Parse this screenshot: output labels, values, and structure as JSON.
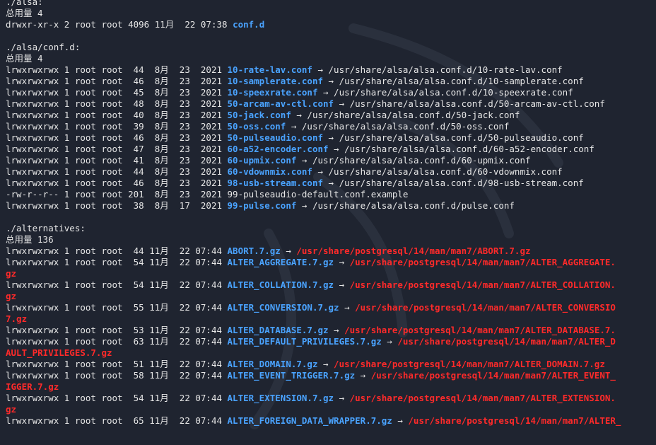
{
  "colors": {
    "background": "#1f2430",
    "text": "#e6e6e6",
    "link_name": "#4aa3ff",
    "broken_target": "#ff2a2a"
  },
  "lines": [
    {
      "text": "./alsa:"
    },
    {
      "text": "总用量 4"
    },
    {
      "prefix": "drwxr-xr-x 2 root root 4096 11月  22 07:38 ",
      "name": "conf.d",
      "name_class": "dir"
    },
    {
      "text": ""
    },
    {
      "text": "./alsa/conf.d:"
    },
    {
      "text": "总用量 4"
    },
    {
      "prefix": "lrwxrwxrwx 1 root root  44  8月  23  2021 ",
      "name": "10-rate-lav.conf",
      "name_class": "dir",
      "arrow": " → ",
      "target": "/usr/share/alsa/alsa.conf.d/10-rate-lav.conf",
      "target_class": "plain"
    },
    {
      "prefix": "lrwxrwxrwx 1 root root  46  8月  23  2021 ",
      "name": "10-samplerate.conf",
      "name_class": "dir",
      "arrow": " → ",
      "target": "/usr/share/alsa/alsa.conf.d/10-samplerate.conf",
      "target_class": "plain"
    },
    {
      "prefix": "lrwxrwxrwx 1 root root  45  8月  23  2021 ",
      "name": "10-speexrate.conf",
      "name_class": "dir",
      "arrow": " → ",
      "target": "/usr/share/alsa/alsa.conf.d/10-speexrate.conf",
      "target_class": "plain"
    },
    {
      "prefix": "lrwxrwxrwx 1 root root  48  8月  23  2021 ",
      "name": "50-arcam-av-ctl.conf",
      "name_class": "dir",
      "arrow": " → ",
      "target": "/usr/share/alsa/alsa.conf.d/50-arcam-av-ctl.conf",
      "target_class": "plain"
    },
    {
      "prefix": "lrwxrwxrwx 1 root root  40  8月  23  2021 ",
      "name": "50-jack.conf",
      "name_class": "dir",
      "arrow": " → ",
      "target": "/usr/share/alsa/alsa.conf.d/50-jack.conf",
      "target_class": "plain"
    },
    {
      "prefix": "lrwxrwxrwx 1 root root  39  8月  23  2021 ",
      "name": "50-oss.conf",
      "name_class": "dir",
      "arrow": " → ",
      "target": "/usr/share/alsa/alsa.conf.d/50-oss.conf",
      "target_class": "plain"
    },
    {
      "prefix": "lrwxrwxrwx 1 root root  46  8月  23  2021 ",
      "name": "50-pulseaudio.conf",
      "name_class": "dir",
      "arrow": " → ",
      "target": "/usr/share/alsa/alsa.conf.d/50-pulseaudio.conf",
      "target_class": "plain"
    },
    {
      "prefix": "lrwxrwxrwx 1 root root  47  8月  23  2021 ",
      "name": "60-a52-encoder.conf",
      "name_class": "dir",
      "arrow": " → ",
      "target": "/usr/share/alsa/alsa.conf.d/60-a52-encoder.conf",
      "target_class": "plain"
    },
    {
      "prefix": "lrwxrwxrwx 1 root root  41  8月  23  2021 ",
      "name": "60-upmix.conf",
      "name_class": "dir",
      "arrow": " → ",
      "target": "/usr/share/alsa/alsa.conf.d/60-upmix.conf",
      "target_class": "plain"
    },
    {
      "prefix": "lrwxrwxrwx 1 root root  44  8月  23  2021 ",
      "name": "60-vdownmix.conf",
      "name_class": "dir",
      "arrow": " → ",
      "target": "/usr/share/alsa/alsa.conf.d/60-vdownmix.conf",
      "target_class": "plain"
    },
    {
      "prefix": "lrwxrwxrwx 1 root root  46  8月  23  2021 ",
      "name": "98-usb-stream.conf",
      "name_class": "dir",
      "arrow": " → ",
      "target": "/usr/share/alsa/alsa.conf.d/98-usb-stream.conf",
      "target_class": "plain"
    },
    {
      "prefix": "-rw-r--r-- 1 root root 201  8月  23  2021 ",
      "name": "99-pulseaudio-default.conf.example",
      "name_class": "plain"
    },
    {
      "prefix": "lrwxrwxrwx 1 root root  38  8月  17  2021 ",
      "name": "99-pulse.conf",
      "name_class": "dir",
      "arrow": " → ",
      "target": "/usr/share/alsa/alsa.conf.d/pulse.conf",
      "target_class": "plain"
    },
    {
      "text": ""
    },
    {
      "text": "./alternatives:"
    },
    {
      "text": "总用量 136"
    },
    {
      "prefix": "lrwxrwxrwx 1 root root  44 11月  22 07:44 ",
      "name": "ABORT.7.gz",
      "name_class": "dir",
      "arrow": " → ",
      "target": "/usr/share/postgresql/14/man/man7/ABORT.7.gz",
      "target_class": "tgt"
    },
    {
      "prefix": "lrwxrwxrwx 1 root root  54 11月  22 07:44 ",
      "name": "ALTER_AGGREGATE.7.gz",
      "name_class": "dir",
      "arrow": " → ",
      "target": "/usr/share/postgresql/14/man/man7/ALTER_AGGREGATE.",
      "target_class": "tgt"
    },
    {
      "cont": "gz"
    },
    {
      "prefix": "lrwxrwxrwx 1 root root  54 11月  22 07:44 ",
      "name": "ALTER_COLLATION.7.gz",
      "name_class": "dir",
      "arrow": " → ",
      "target": "/usr/share/postgresql/14/man/man7/ALTER_COLLATION.",
      "target_class": "tgt"
    },
    {
      "cont": "gz"
    },
    {
      "prefix": "lrwxrwxrwx 1 root root  55 11月  22 07:44 ",
      "name": "ALTER_CONVERSION.7.gz",
      "name_class": "dir",
      "arrow": " → ",
      "target": "/usr/share/postgresql/14/man/man7/ALTER_CONVERSIO",
      "target_class": "tgt"
    },
    {
      "cont": "7.gz"
    },
    {
      "prefix": "lrwxrwxrwx 1 root root  53 11月  22 07:44 ",
      "name": "ALTER_DATABASE.7.gz",
      "name_class": "dir",
      "arrow": " → ",
      "target": "/usr/share/postgresql/14/man/man7/ALTER_DATABASE.7.",
      "target_class": "tgt"
    },
    {
      "prefix": "lrwxrwxrwx 1 root root  63 11月  22 07:44 ",
      "name": "ALTER_DEFAULT_PRIVILEGES.7.gz",
      "name_class": "dir",
      "arrow": " → ",
      "target": "/usr/share/postgresql/14/man/man7/ALTER_D",
      "target_class": "tgt"
    },
    {
      "cont": "AULT_PRIVILEGES.7.gz"
    },
    {
      "prefix": "lrwxrwxrwx 1 root root  51 11月  22 07:44 ",
      "name": "ALTER_DOMAIN.7.gz",
      "name_class": "dir",
      "arrow": " → ",
      "target": "/usr/share/postgresql/14/man/man7/ALTER_DOMAIN.7.gz",
      "target_class": "tgt"
    },
    {
      "prefix": "lrwxrwxrwx 1 root root  58 11月  22 07:44 ",
      "name": "ALTER_EVENT_TRIGGER.7.gz",
      "name_class": "dir",
      "arrow": " → ",
      "target": "/usr/share/postgresql/14/man/man7/ALTER_EVENT_",
      "target_class": "tgt"
    },
    {
      "cont": "IGGER.7.gz"
    },
    {
      "prefix": "lrwxrwxrwx 1 root root  54 11月  22 07:44 ",
      "name": "ALTER_EXTENSION.7.gz",
      "name_class": "dir",
      "arrow": " → ",
      "target": "/usr/share/postgresql/14/man/man7/ALTER_EXTENSION.",
      "target_class": "tgt"
    },
    {
      "cont": "gz"
    },
    {
      "prefix": "lrwxrwxrwx 1 root root  65 11月  22 07:44 ",
      "name": "ALTER_FOREIGN_DATA_WRAPPER.7.gz",
      "name_class": "dir",
      "arrow": " → ",
      "target": "/usr/share/postgresql/14/man/man7/ALTER_",
      "target_class": "tgt"
    }
  ]
}
